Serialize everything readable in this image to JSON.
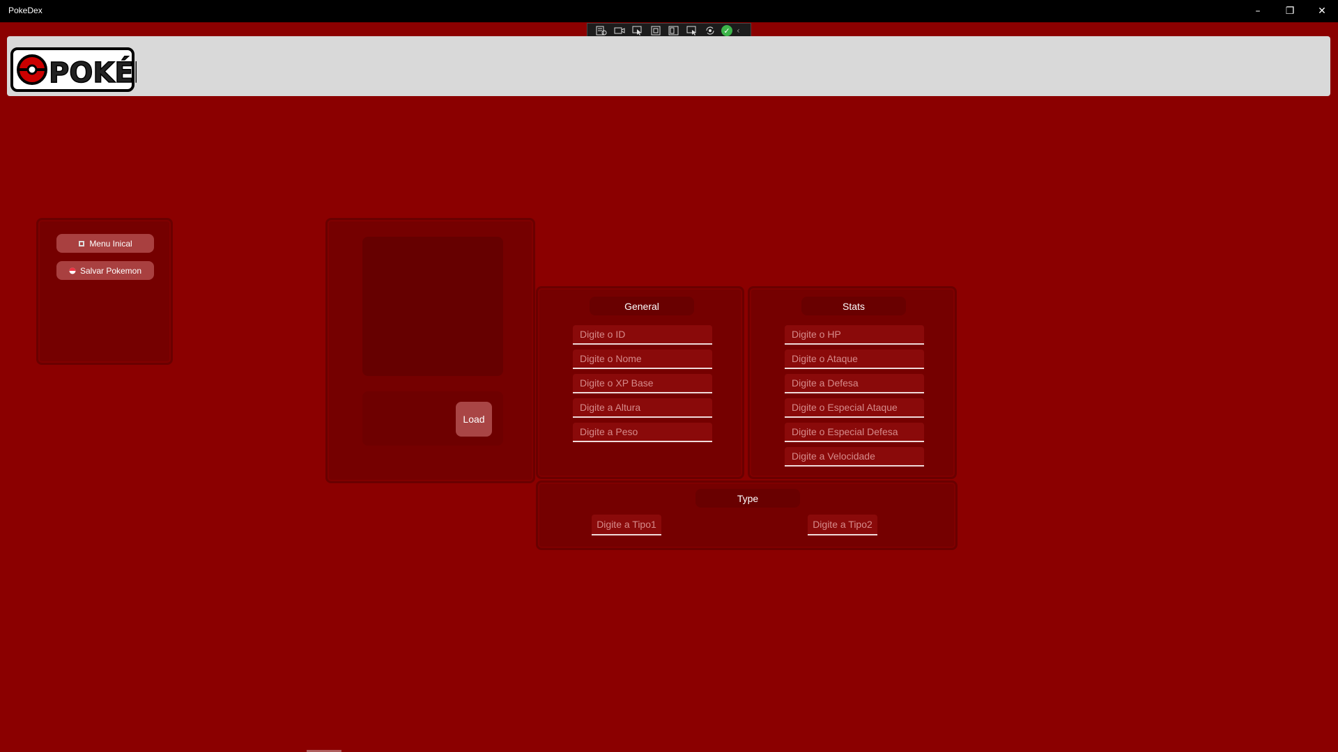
{
  "window": {
    "title": "PokeDex",
    "controls": {
      "minimize": "–",
      "maximize": "❐",
      "close": "✕"
    }
  },
  "devtools": {
    "icons": [
      "live-visual-tree-icon",
      "record-icon",
      "select-element-icon",
      "display-layout-adorners-icon",
      "track-focus-icon",
      "binding-failures-icon",
      "hot-reload-icon",
      "check-icon",
      "collapse-icon"
    ],
    "check_glyph": "✓",
    "collapse_glyph": "‹"
  },
  "header": {
    "logo_text": "POKÉDEX"
  },
  "sidebar": {
    "items": [
      {
        "label": "Menu Inical",
        "icon": "home-icon"
      },
      {
        "label": "Salvar Pokemon",
        "icon": "pokeball-icon"
      }
    ]
  },
  "image_panel": {
    "load_label": "Load"
  },
  "general": {
    "title": "General",
    "fields": [
      "Digite o ID",
      "Digite o Nome",
      "Digite o XP Base",
      "Digite a Altura",
      "Digite a Peso"
    ]
  },
  "stats": {
    "title": "Stats",
    "fields": [
      "Digite o HP",
      "Digite o Ataque",
      "Digite a Defesa",
      "Digite o Especial Ataque",
      "Digite o Especial Defesa",
      "Digite a Velocidade"
    ]
  },
  "type": {
    "title": "Type",
    "fields": [
      "Digite a Tipo1",
      "Digite a Tipo2"
    ]
  },
  "colors": {
    "background": "#8b0000",
    "panel": "#750000",
    "button": "#a94040",
    "header": "#d9d9d9"
  }
}
